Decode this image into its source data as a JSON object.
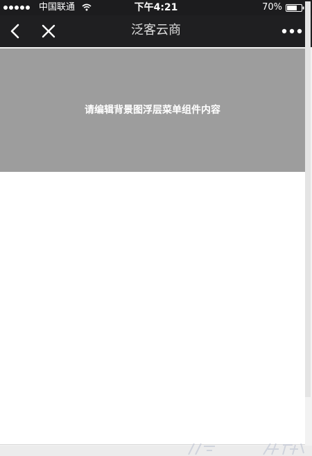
{
  "status_bar": {
    "carrier": "中国联通",
    "time": "下午4:21",
    "battery_percent": "70%",
    "battery_level": 0.7,
    "icons": [
      "signal-dots-icon",
      "wifi-icon",
      "battery-icon"
    ]
  },
  "nav": {
    "title": "泛客云商",
    "back_icon": "chevron-left-icon",
    "close_icon": "close-icon",
    "more_icon": "more-dots-icon"
  },
  "content": {
    "banner_text": "请编辑背景图浮层菜单组件内容"
  },
  "colors": {
    "nav_background": "#1f1f21",
    "banner_background": "#9d9d9d",
    "page_background": "#ffffff"
  }
}
